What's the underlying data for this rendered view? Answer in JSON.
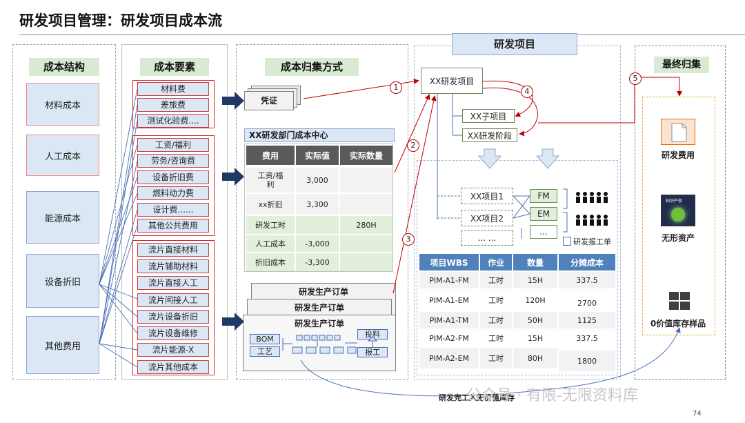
{
  "title": "研发项目管理：研发项目成本流",
  "page_number": "74",
  "watermark": "公众号 · 有限-无限资料库",
  "cost_structure": {
    "heading": "成本结构",
    "items": [
      "材料成本",
      "人工成本",
      "能源成本",
      "设备折旧",
      "其他费用"
    ]
  },
  "cost_elements": {
    "heading": "成本要素",
    "group1": [
      "材料费",
      "差旅费",
      "测试化验费...."
    ],
    "group2": [
      "工资/福利",
      "劳务/咨询费",
      "设备折旧费",
      "燃料动力费",
      "设计费......",
      "其他公共费用"
    ],
    "group3": [
      "流片直接材料",
      "流片辅助材料",
      "流片直接人工",
      "流片间接人工",
      "流片设备折旧",
      "流片设备维修",
      "流片能源-X",
      "流片其他成本"
    ]
  },
  "collection_method": {
    "heading": "成本归集方式",
    "voucher_label": "凭证",
    "cost_center": {
      "title": "XX研发部门成本中心",
      "headers": [
        "费用",
        "实际值",
        "实际数量"
      ],
      "rows": [
        [
          "工资/福利",
          "3,000",
          ""
        ],
        [
          "xx折旧",
          "3,300",
          ""
        ],
        [
          "研发工时",
          "",
          "280H"
        ],
        [
          "人工成本",
          "-3,000",
          ""
        ],
        [
          "折旧成本",
          "-3,300",
          ""
        ]
      ]
    },
    "orders": {
      "title": "研发生产订单",
      "bom": "BOM",
      "process": "工艺",
      "feed": "投料",
      "report": "报工"
    }
  },
  "rd_project": {
    "heading": "研发项目",
    "main_node": "XX研发项目",
    "sub_project": "XX子项目",
    "stage": "XX研发阶段",
    "projects": [
      "XX项目1",
      "XX项目2",
      "... ..."
    ],
    "roles": [
      "FM",
      "EM",
      "..."
    ],
    "report_label": "研发报工单",
    "wbs_table": {
      "headers": [
        "项目WBS",
        "作业",
        "数量",
        "分摊成本"
      ],
      "rows": [
        [
          "PIM-A1-FM",
          "工时",
          "15H",
          "337.5"
        ],
        [
          "PIM-A1-EM",
          "工时",
          "120H",
          "2700"
        ],
        [
          "PIM-A1-TM",
          "工时",
          "50H",
          "1125"
        ],
        [
          "PIM-A2-FM",
          "工时",
          "15H",
          "337.5"
        ],
        [
          "PIM-A2-EM",
          "工时",
          "80H",
          "1800"
        ]
      ]
    }
  },
  "final_collection": {
    "heading": "最终归集",
    "items": [
      "研发费用",
      "无形资产",
      "0价值库存样品"
    ],
    "intangible_cover_text": "知识产权"
  },
  "flow_steps": [
    "1",
    "2",
    "3",
    "4",
    "5"
  ],
  "bottom_note": "研发完工入无价值库存",
  "colors": {
    "accent_green": "#d9ead3",
    "box_blue": "#dbe7f5",
    "line_red": "#c00000",
    "line_blue": "#4a6fb5",
    "table_blue": "#4f81bd"
  }
}
